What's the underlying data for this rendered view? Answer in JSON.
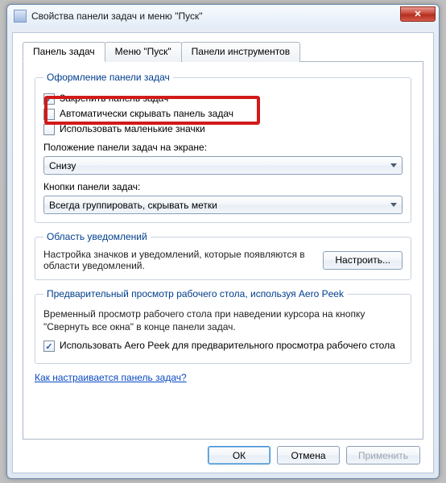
{
  "window": {
    "title": "Свойства панели задач и меню \"Пуск\"",
    "close_glyph": "✕"
  },
  "tabs": {
    "taskbar": "Панель задач",
    "start": "Меню \"Пуск\"",
    "toolbars": "Панели инструментов"
  },
  "appearance": {
    "legend": "Оформление панели задач",
    "lock": "Закрепить панель задач",
    "autohide": "Автоматически скрывать панель задач",
    "smallicons": "Использовать маленькие значки",
    "position_label": "Положение панели задач на экране:",
    "position_value": "Снизу",
    "buttons_label": "Кнопки панели задач:",
    "buttons_value": "Всегда группировать, скрывать метки"
  },
  "notif": {
    "legend": "Область уведомлений",
    "desc": "Настройка значков и уведомлений, которые появляются в области уведомлений.",
    "button": "Настроить..."
  },
  "aero": {
    "legend": "Предварительный просмотр рабочего стола, используя Aero Peek",
    "desc": "Временный просмотр рабочего стола при наведении курсора на кнопку \"Свернуть все окна\" в конце панели задач.",
    "checkbox": "Использовать Aero Peek для предварительного просмотра рабочего стола"
  },
  "help_link": "Как настраивается панель задач?",
  "buttons": {
    "ok": "ОК",
    "cancel": "Отмена",
    "apply": "Применить"
  }
}
